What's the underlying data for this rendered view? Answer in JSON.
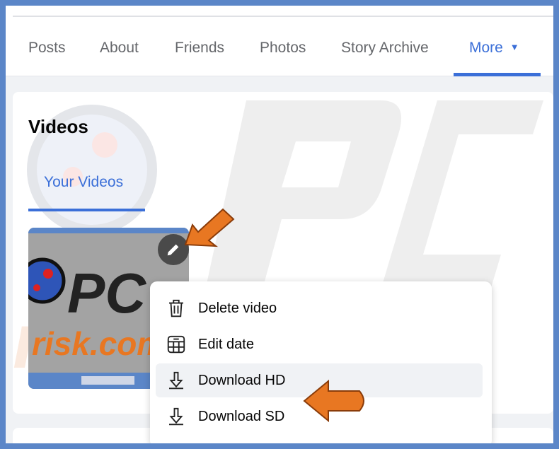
{
  "nav": {
    "tabs": [
      {
        "label": "Posts"
      },
      {
        "label": "About"
      },
      {
        "label": "Friends"
      },
      {
        "label": "Photos"
      },
      {
        "label": "Story Archive"
      },
      {
        "label": "More"
      }
    ],
    "active": "More"
  },
  "videos": {
    "title": "Videos",
    "subtab": "Your Videos"
  },
  "menu": {
    "items": [
      {
        "label": "Delete video",
        "icon": "trash-icon"
      },
      {
        "label": "Edit date",
        "icon": "calendar-icon"
      },
      {
        "label": "Download HD",
        "icon": "download-icon"
      },
      {
        "label": "Download SD",
        "icon": "download-icon"
      }
    ]
  },
  "colors": {
    "accent": "#3b6fd8",
    "border": "#5b86c8",
    "arrow": "#e87722"
  }
}
